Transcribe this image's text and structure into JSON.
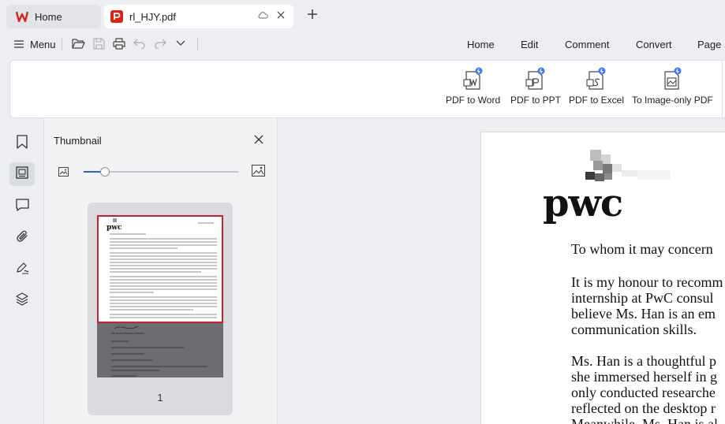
{
  "tabs": {
    "home_label": "Home",
    "pdf_label": "rl_HJY.pdf"
  },
  "toolbar": {
    "menu_label": "Menu"
  },
  "main_tabs": [
    "Home",
    "Edit",
    "Comment",
    "Convert",
    "Page"
  ],
  "ribbon": {
    "buttons": [
      "PDF to Word",
      "PDF to PPT",
      "PDF to Excel",
      "To Image-only PDF"
    ]
  },
  "thumbnail_panel": {
    "title": "Thumbnail",
    "zoom_level": 0.14,
    "page_number": "1"
  },
  "document": {
    "logo_text": "pwc",
    "lines": [
      "To whom it may concern",
      "It is my honour to recomm",
      "internship at PwC consul",
      "believe Ms. Han is an em",
      "communication skills.",
      "Ms. Han is a thoughtful p",
      "she immersed herself in g",
      "only conducted researche",
      "reflected on the desktop r",
      "Meanwhile, Ms. Han is al"
    ]
  },
  "colors": {
    "accent": "#2a63d4",
    "pdf_brand": "#d9241c",
    "selection": "#c8202c"
  }
}
